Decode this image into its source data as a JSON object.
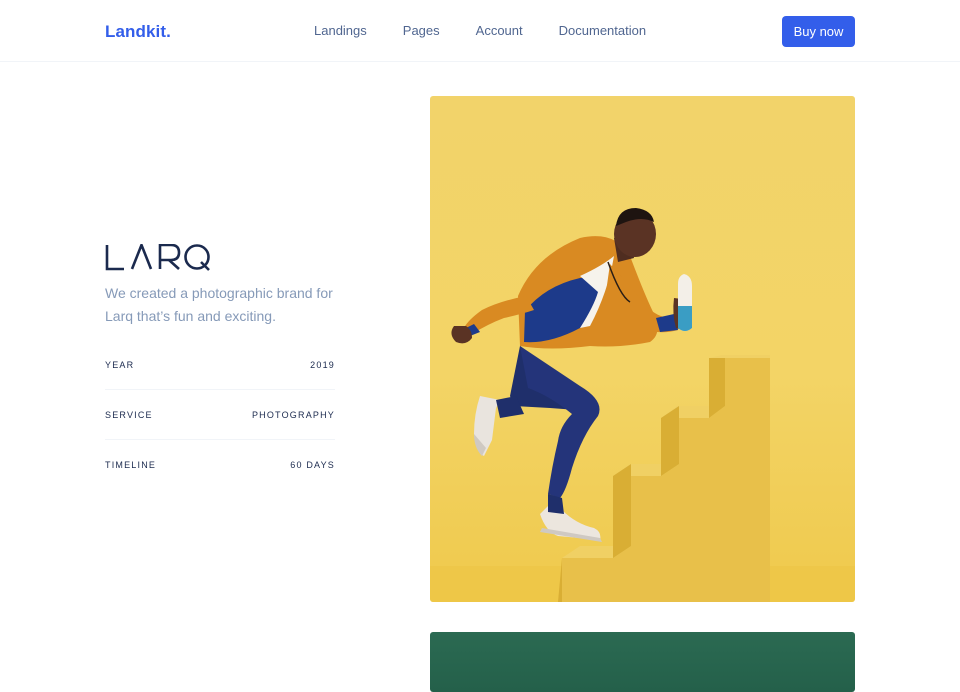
{
  "navbar": {
    "brand": "Landkit.",
    "links": [
      "Landings",
      "Pages",
      "Account",
      "Documentation"
    ],
    "cta": "Buy now"
  },
  "project": {
    "logo_text": "LARQ",
    "description": "We created a photographic brand for Larq that’s fun and exciting.",
    "details": [
      {
        "label": "Year",
        "value": "2019"
      },
      {
        "label": "Service",
        "value": "Photography"
      },
      {
        "label": "Timeline",
        "value": "60 Days"
      }
    ]
  },
  "colors": {
    "accent": "#335eea",
    "text_dark": "#1b2a4e",
    "text_muted": "#869ab8",
    "hero_bg": "#f2d36a",
    "second_bg": "#2b6a52"
  }
}
